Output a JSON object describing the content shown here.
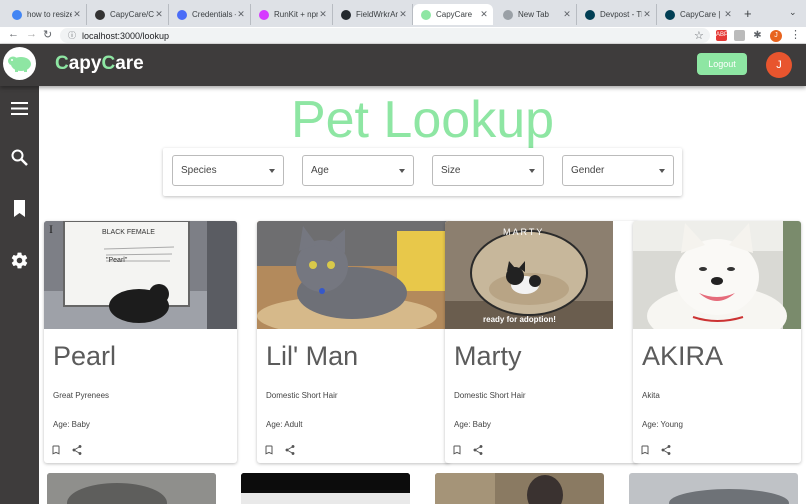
{
  "browser": {
    "tabs": [
      {
        "title": "how to resize",
        "fav_color": "#4285f4"
      },
      {
        "title": "CapyCare/Cap",
        "fav_color": "#333333"
      },
      {
        "title": "Credentials –",
        "fav_color": "#4a6cf7"
      },
      {
        "title": "RunKit + npm",
        "fav_color": "#d63aff"
      },
      {
        "title": "FieldWrkrAnal",
        "fav_color": "#24292e"
      },
      {
        "title": "CapyCare",
        "fav_color": "#8ee6a3"
      },
      {
        "title": "New Tab",
        "fav_color": "#9aa0a6"
      },
      {
        "title": "Devpost - The",
        "fav_color": "#003e54"
      },
      {
        "title": "CapyCare | De",
        "fav_color": "#003e54"
      }
    ],
    "url": "localhost:3000/lookup",
    "profile_initial": "J"
  },
  "header": {
    "brand_c1": "C",
    "brand_mid": "apy",
    "brand_c2": "C",
    "brand_end": "are",
    "logout_label": "Logout",
    "avatar_initial": "J"
  },
  "sidebar": {
    "icons": [
      "menu-icon",
      "search-icon",
      "bookmark-icon",
      "settings-icon"
    ]
  },
  "page": {
    "title": "Pet Lookup"
  },
  "filters": [
    {
      "label": "Species"
    },
    {
      "label": "Age"
    },
    {
      "label": "Size"
    },
    {
      "label": "Gender"
    }
  ],
  "pets": [
    {
      "name": "Pearl",
      "breed": "Great Pyrenees",
      "age": "Age: Baby",
      "sign_line1": "BLACK FEMALE",
      "sign_line2": "\"Pearl\""
    },
    {
      "name": "Lil' Man",
      "breed": "Domestic Short Hair",
      "age": "Age: Adult"
    },
    {
      "name": "Marty",
      "breed": "Domestic Short Hair",
      "age": "Age: Baby",
      "photo_top": "MARTY",
      "photo_caption": "ready for adoption!"
    },
    {
      "name": "AKIRA",
      "breed": "Akita",
      "age": "Age: Young"
    }
  ],
  "colors": {
    "accent": "#8ee6a3",
    "header_bg": "#3e3c3c",
    "avatar": "#e8552e"
  }
}
